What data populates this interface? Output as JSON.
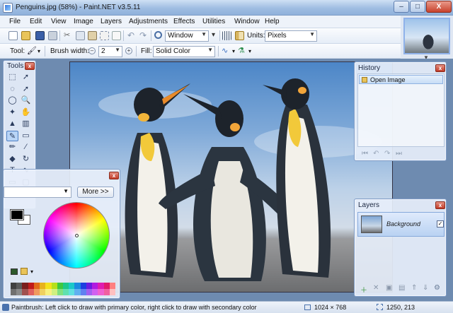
{
  "window": {
    "title": "Penguins.jpg (58%) - Paint.NET v3.5.11",
    "minimize": "–",
    "maximize": "□",
    "close": "X"
  },
  "menu": [
    "File",
    "Edit",
    "View",
    "Image",
    "Layers",
    "Adjustments",
    "Effects",
    "Utilities",
    "Window",
    "Help"
  ],
  "toolbar": {
    "zoom_value": "Window",
    "units_label": "Units:",
    "units_value": "Pixels",
    "tool_label": "Tool:",
    "brush_width_label": "Brush width:",
    "brush_width_value": "2",
    "fill_label": "Fill:",
    "fill_value": "Solid Color"
  },
  "tools_panel": {
    "title": "Tools",
    "close": "x",
    "icons": [
      "rectangle-select-icon",
      "move-selection-icon",
      "lasso-select-icon",
      "move-selection-alt-icon",
      "ellipse-select-icon",
      "zoom-icon",
      "magic-wand-icon",
      "pan-hand-icon",
      "paint-bucket-icon",
      "gradient-icon",
      "paintbrush-icon",
      "eraser-icon",
      "pencil-icon",
      "color-picker-icon",
      "clone-stamp-icon",
      "recolor-icon",
      "text-icon",
      "line-curve-icon",
      "rectangle-icon",
      "rounded-rectangle-icon",
      "ellipse-shape-icon",
      "freeform-shape-icon"
    ]
  },
  "colors_panel": {
    "close": "x",
    "more_button": "More >>",
    "palette": [
      "#404040",
      "#5a5a5a",
      "#7a1d1d",
      "#c01b1b",
      "#e06a1a",
      "#e8b21c",
      "#f4e21c",
      "#b6e01c",
      "#3fc83f",
      "#1cc88a",
      "#1cc8c8",
      "#1c8ae0",
      "#1c3fe0",
      "#6a1ce0",
      "#b01ce0",
      "#e01cb0",
      "#e01c6a",
      "#ff8080",
      "#707070",
      "#8a8a8a",
      "#a05050",
      "#e06060",
      "#f09a60",
      "#f0d060",
      "#f8f080",
      "#d0f080",
      "#80e080",
      "#60e0b0",
      "#60e0e0",
      "#60b0f0",
      "#6080f0",
      "#a060f0",
      "#d060f0",
      "#f060d0",
      "#f060a0",
      "#ffc0c0"
    ]
  },
  "history_panel": {
    "title": "History",
    "close": "x",
    "items": [
      "Open Image"
    ],
    "controls": [
      "⏮",
      "↶",
      "↷",
      "⏭"
    ]
  },
  "layers_panel": {
    "title": "Layers",
    "close": "x",
    "layer_name": "Background",
    "layer_visible": "✓",
    "controls": [
      "＋",
      "✕",
      "▣",
      "▤",
      "⇑",
      "⇓",
      "⚙"
    ]
  },
  "status": {
    "message": "Paintbrush: Left click to draw with primary color, right click to draw with secondary color",
    "image_size": "1024 × 768",
    "cursor_position": "1250, 213"
  }
}
